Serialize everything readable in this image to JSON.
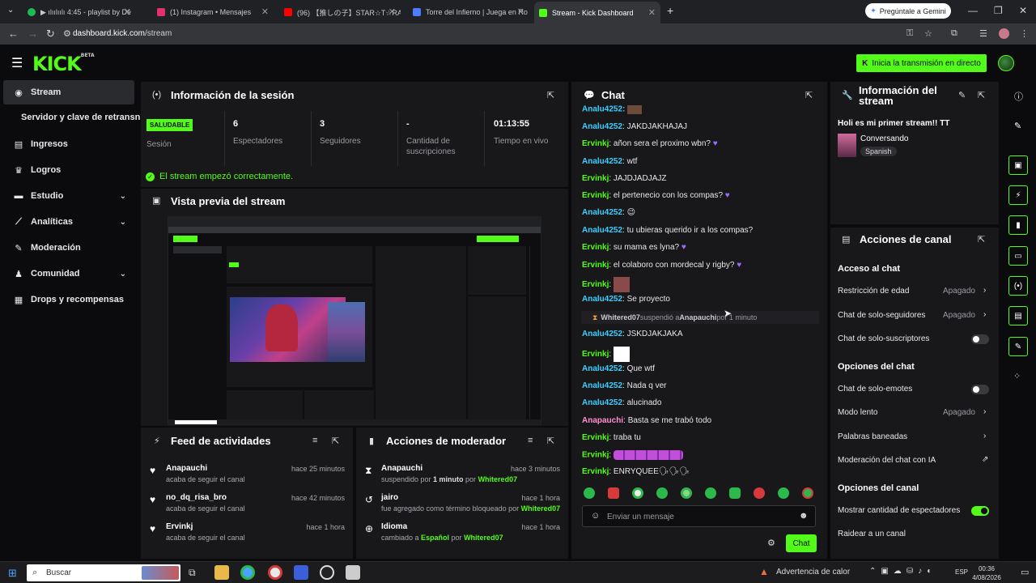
{
  "browser": {
    "tabs": [
      {
        "title": "▶ ılıılıılı 4:45 - playlist by De",
        "color": "#1db954"
      },
      {
        "title": "(1) Instagram • Mensajes",
        "color": "#e1306c"
      },
      {
        "title": "(96) 【推しの子】STAR☆T☆RAIN/",
        "color": "#ff0000"
      },
      {
        "title": "Torre del Infierno | Juega en Ro",
        "color": "#4f7cff"
      },
      {
        "title": "Stream - Kick Dashboard",
        "color": "#53fc18"
      }
    ],
    "new_tab": "+",
    "gemini": "Pregúntale a Gemini",
    "url_host": "dashboard.kick.com",
    "url_path": "/stream"
  },
  "header": {
    "logo": "KICK",
    "logo_beta": "BETA",
    "go_live": "Inicia la transmisión en directo"
  },
  "sidebar": {
    "items": [
      {
        "label": "Stream",
        "icon": "stream-icon"
      },
      {
        "label": "Ingresos",
        "icon": "money-icon"
      },
      {
        "label": "Logros",
        "icon": "trophy-icon"
      },
      {
        "label": "Estudio",
        "icon": "studio-icon"
      },
      {
        "label": "Analíticas",
        "icon": "chart-icon"
      },
      {
        "label": "Moderación",
        "icon": "shield-icon"
      },
      {
        "label": "Comunidad",
        "icon": "community-icon"
      },
      {
        "label": "Drops y recompensas",
        "icon": "gift-icon"
      }
    ],
    "sub": "Servidor y clave de retransn"
  },
  "session": {
    "title": "Información de la sesión",
    "health": "SALUDABLE",
    "health_label": "Sesión",
    "stats": [
      {
        "value": "6",
        "label": "Espectadores"
      },
      {
        "value": "3",
        "label": "Seguidores"
      },
      {
        "value": "-",
        "label": "Cantidad de suscripciones"
      },
      {
        "value": "01:13:55",
        "label": "Tiempo en vivo"
      }
    ],
    "ok_message": "El stream empezó correctamente."
  },
  "preview": {
    "title": "Vista previa del stream"
  },
  "activity": {
    "title": "Feed de actividades",
    "items": [
      {
        "name": "Anapauchi",
        "sub": "acaba de seguir el canal",
        "time": "hace 25 minutos"
      },
      {
        "name": "no_dq_risa_bro",
        "sub": "acaba de seguir el canal",
        "time": "hace 42 minutos"
      },
      {
        "name": "Ervinkj",
        "sub": "acaba de seguir el canal",
        "time": "hace 1 hora"
      }
    ]
  },
  "modactions": {
    "title": "Acciones de moderador",
    "items": [
      {
        "name": "Anapauchi",
        "sub_a": "suspendido por ",
        "sub_b": "1 minuto",
        "sub_c": " por ",
        "actor": "Whitered07",
        "time": "hace 3 minutos"
      },
      {
        "name": "jairo",
        "sub_a": "fue agregado como término bloqueado por ",
        "sub_b": "",
        "sub_c": "",
        "actor": "Whitered07",
        "time": "hace 1 hora"
      },
      {
        "name": "Idioma",
        "sub_a": "cambiado a ",
        "sub_b": "Español",
        "sub_c": " por ",
        "actor": "Whitered07",
        "time": "hace 1 hora"
      }
    ]
  },
  "chat": {
    "title": "Chat",
    "top_user": "Analu4252:",
    "messages": [
      {
        "user": "Analu4252",
        "text": "JAKDJAKHAJAJ",
        "heart": false
      },
      {
        "user": "Ervinkj",
        "text": "añon sera el proximo wbn?",
        "heart": true
      },
      {
        "user": "Analu4252",
        "text": "wtf",
        "heart": false
      },
      {
        "user": "Ervinkj",
        "text": "JAJDJADJAJZ",
        "heart": false
      },
      {
        "user": "Ervinkj",
        "text": "el pertenecio con los compas?",
        "heart": true
      },
      {
        "user": "Analu4252",
        "text": "😉",
        "heart": false
      },
      {
        "user": "Analu4252",
        "text": "tu ubieras querido ir a los compas?",
        "heart": false
      },
      {
        "user": "Ervinkj",
        "text": "su mama es lyna?",
        "heart": true
      },
      {
        "user": "Ervinkj",
        "text": "el colaboro con mordecal y rigby?",
        "heart": true
      },
      {
        "user": "Ervinkj",
        "text": "",
        "heart": false
      },
      {
        "user": "Analu4252",
        "text": "Se proyecto",
        "heart": false
      }
    ],
    "system": {
      "actor": "Whitered07",
      "mid": " suspendió a ",
      "target": "Anapauchi",
      "end": " por 1 minuto"
    },
    "messages2": [
      {
        "user": "Analu4252",
        "text": "JSKDJAKJAKA"
      },
      {
        "user": "Ervinkj",
        "text": ""
      },
      {
        "user": "Analu4252",
        "text": "Que wtf"
      },
      {
        "user": "Analu4252",
        "text": "Nada q ver"
      },
      {
        "user": "Analu4252",
        "text": "alucinado"
      },
      {
        "user": "Anapauchi",
        "text": "Basta se me trabó todo"
      },
      {
        "user": "Ervinkj",
        "text": "traba tu"
      },
      {
        "user": "Ervinkj",
        "text": ""
      },
      {
        "user": "Ervinkj",
        "text": "ENRYQUEE🗣🗣🗣"
      }
    ],
    "input_placeholder": "Enviar un mensaje",
    "send": "Chat"
  },
  "stream_info": {
    "title": "Información del stream",
    "stream_title": "Holi es mi primer stream!! TT",
    "category": "Conversando",
    "language": "Spanish"
  },
  "channel_actions": {
    "title": "Acciones de canal",
    "sections": {
      "access": "Acceso al chat",
      "chat_opts": "Opciones del chat",
      "channel_opts": "Opciones del canal"
    },
    "rows": {
      "age": {
        "label": "Restricción de edad",
        "value": "Apagado"
      },
      "followers": {
        "label": "Chat de solo-seguidores",
        "value": "Apagado"
      },
      "subs": {
        "label": "Chat de solo-suscriptores",
        "on": false
      },
      "emotes": {
        "label": "Chat de solo-emotes",
        "on": false
      },
      "slow": {
        "label": "Modo lento",
        "value": "Apagado"
      },
      "banned": {
        "label": "Palabras baneadas"
      },
      "ai": {
        "label": "Moderación del chat con IA"
      },
      "viewers": {
        "label": "Mostrar cantidad de espectadores",
        "on": true
      },
      "raid": {
        "label": "Raidear a un canal"
      }
    }
  },
  "taskbar": {
    "search": "Buscar",
    "weather": "Advertencia de calor",
    "lang": "ESP",
    "time": "00:36",
    "date": "4/08/2026"
  }
}
